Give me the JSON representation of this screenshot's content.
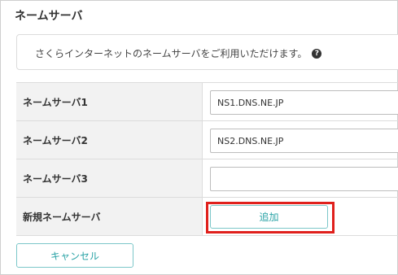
{
  "section": {
    "title": "ネームサーバ"
  },
  "info": {
    "text": "さくらインターネットのネームサーバをご利用いただけます。",
    "help_icon": "question-circle-icon"
  },
  "table": {
    "rows": [
      {
        "label": "ネームサーバ1",
        "value": "NS1.DNS.NE.JP"
      },
      {
        "label": "ネームサーバ2",
        "value": "NS2.DNS.NE.JP"
      },
      {
        "label": "ネームサーバ3",
        "value": ""
      },
      {
        "label": "新規ネームサーバ",
        "button": "追加"
      }
    ]
  },
  "actions": {
    "cancel_label": "キャンセル"
  },
  "colors": {
    "accent": "#2aa3a6",
    "highlight": "#e0201c"
  }
}
